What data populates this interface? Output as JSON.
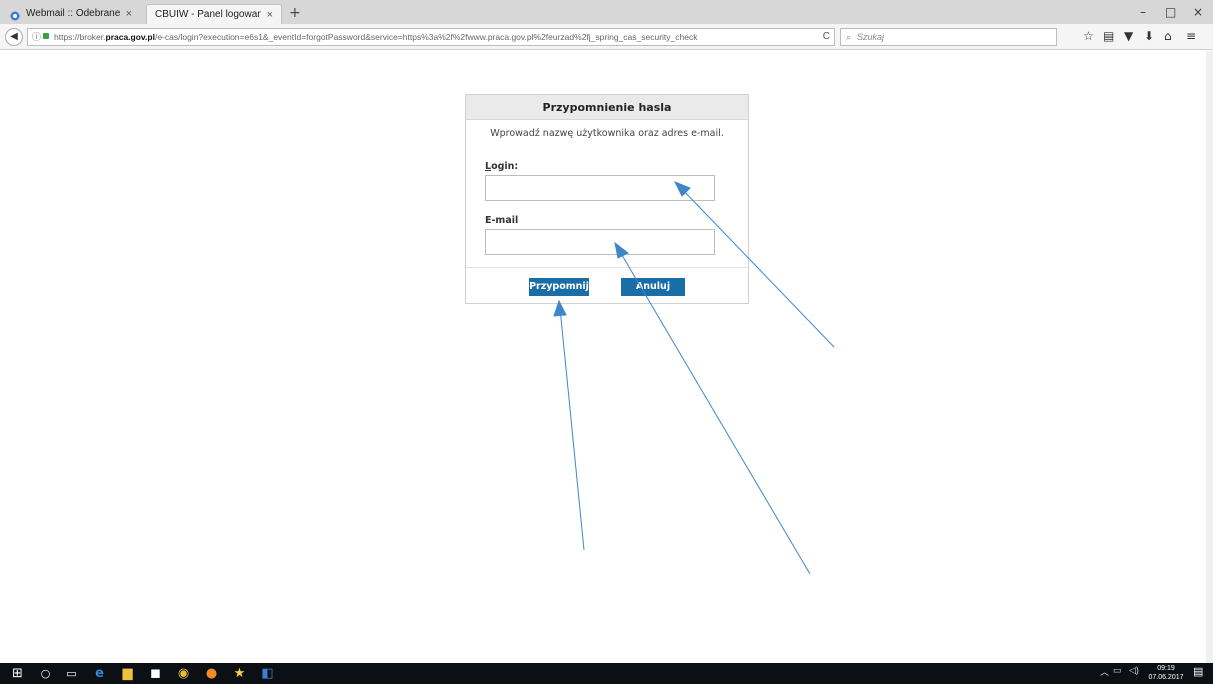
{
  "browser": {
    "tabs": [
      {
        "label": "Webmail :: Odebrane",
        "active": false
      },
      {
        "label": "CBUIW - Panel logowania",
        "active": true
      }
    ],
    "new_tab_icon": "+",
    "close_tab_icon": "×",
    "window_controls": {
      "minimize": "–",
      "maximize": "□",
      "close": "×"
    },
    "url_prefix": "https://broker.",
    "url_domain": "praca.gov.pl",
    "url_suffix": "/e-cas/login?execution=e6s1&_eventId=forgotPassword&service=https%3a%2f%2fwww.praca.gov.pl%2feurzad%2fj_spring_cas_security_check",
    "search_placeholder": "Szukaj",
    "reload_icon": "C"
  },
  "dialog": {
    "title": "Przypomnienie hasla",
    "instruction": "Wprowadź nazwę użytkownika oraz adres e-mail.",
    "login_label_first": "L",
    "login_label_rest": "ogin:",
    "login_value": "",
    "email_label": "E-mail",
    "email_value": "",
    "remind_button": "Przypomnij",
    "cancel_button": "Anuluj"
  },
  "taskbar": {
    "time": "09:19",
    "date": "07.06.2017"
  },
  "colors": {
    "primary_button": "#1a6ea8",
    "annotation_arrow": "#3f87c9",
    "taskbar": "#0c1014"
  }
}
